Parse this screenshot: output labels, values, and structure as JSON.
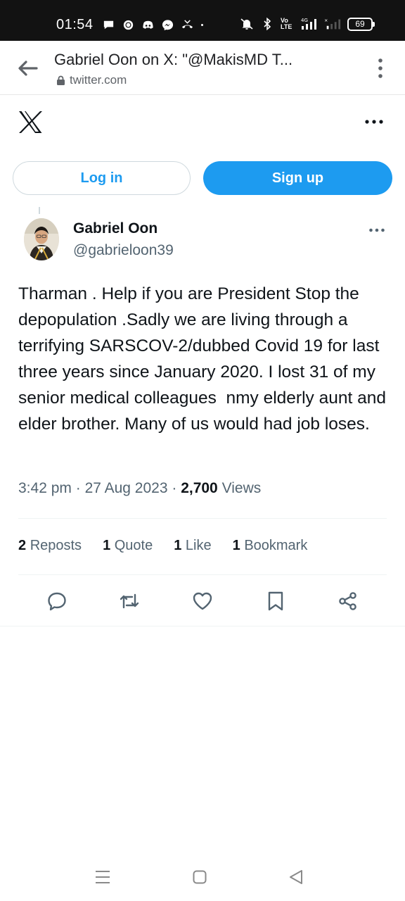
{
  "status_bar": {
    "time": "01:54",
    "battery": "69",
    "notification_icons": [
      "chat-bubble-icon",
      "signal-app-icon",
      "discord-icon",
      "messenger-icon",
      "missed-call-icon",
      "dot-icon"
    ],
    "system_icons": [
      "mute-icon",
      "bluetooth-icon",
      "volte-icon",
      "signal-4g-icon",
      "signal-icon",
      "battery-icon"
    ],
    "volte_label": "Vo LTE",
    "network_label": "4G"
  },
  "browser": {
    "title": "Gabriel Oon on X: \"@MakisMD T...",
    "url": "twitter.com"
  },
  "auth": {
    "login_label": "Log in",
    "signup_label": "Sign up"
  },
  "tweet": {
    "author_name": "Gabriel Oon",
    "author_handle": "@gabrieloon39",
    "text": "Tharman . Help if you are President Stop the depopulation .Sadly we are living through a terrifying SARSCOV-2/dubbed Covid 19 for last three years since January 2020. I lost 31 of my senior medical colleagues  nmy elderly aunt and elder brother. Many of us would had job loses.",
    "time": "3:42 pm",
    "date": "27 Aug 2023",
    "views_count": "2,700",
    "views_label": "Views",
    "stats": [
      {
        "count": "2",
        "label": "Reposts"
      },
      {
        "count": "1",
        "label": "Quote"
      },
      {
        "count": "1",
        "label": "Like"
      },
      {
        "count": "1",
        "label": "Bookmark"
      }
    ]
  },
  "colors": {
    "accent": "#1d9bf0",
    "text_primary": "#0f1419",
    "text_secondary": "#536471",
    "status_bar_bg": "#121212"
  }
}
